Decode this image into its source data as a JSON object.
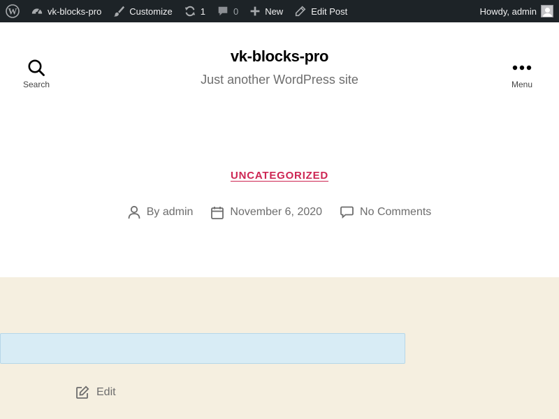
{
  "adminbar": {
    "site_name": "vk-blocks-pro",
    "customize": "Customize",
    "updates_count": "1",
    "comments_count": "0",
    "new": "New",
    "edit_post": "Edit Post",
    "howdy": "Howdy, admin"
  },
  "header": {
    "site_title": "vk-blocks-pro",
    "site_description": "Just another WordPress site",
    "search_label": "Search",
    "menu_label": "Menu"
  },
  "entry": {
    "category": "UNCATEGORIZED",
    "author": "By admin",
    "date": "November 6, 2020",
    "comments": "No Comments"
  },
  "content": {
    "edit_label": "Edit"
  },
  "colors": {
    "adminbar_bg": "#1d2327",
    "accent": "#cd2653",
    "content_bg": "#f5efe0",
    "block_bg": "#d8ecf5"
  }
}
